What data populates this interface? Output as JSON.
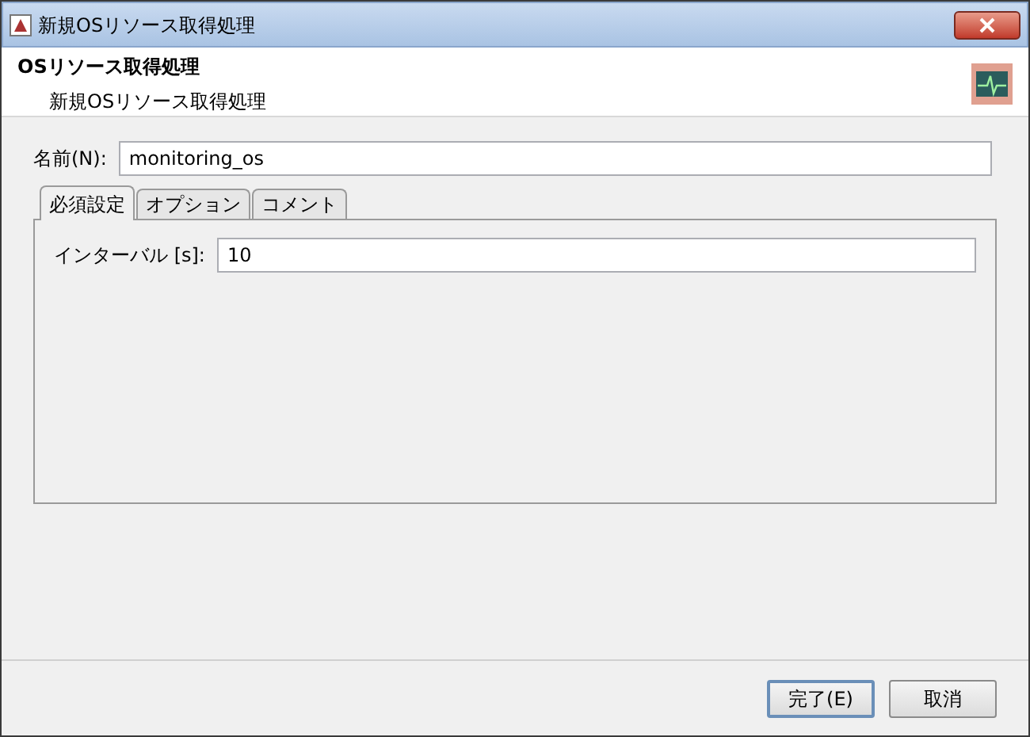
{
  "window": {
    "title": "新規OSリソース取得処理"
  },
  "header": {
    "title": "OSリソース取得処理",
    "subtitle": "新規OSリソース取得処理"
  },
  "name_field": {
    "label": "名前(N):",
    "value": "monitoring_os"
  },
  "tabs": [
    {
      "label": "必須設定",
      "selected": true
    },
    {
      "label": "オプション",
      "selected": false
    },
    {
      "label": "コメント",
      "selected": false
    }
  ],
  "interval_field": {
    "label": "インターバル [s]:",
    "value": "10"
  },
  "buttons": [
    {
      "label": "完了(E)",
      "default": true
    },
    {
      "label": "取消",
      "default": false
    }
  ]
}
